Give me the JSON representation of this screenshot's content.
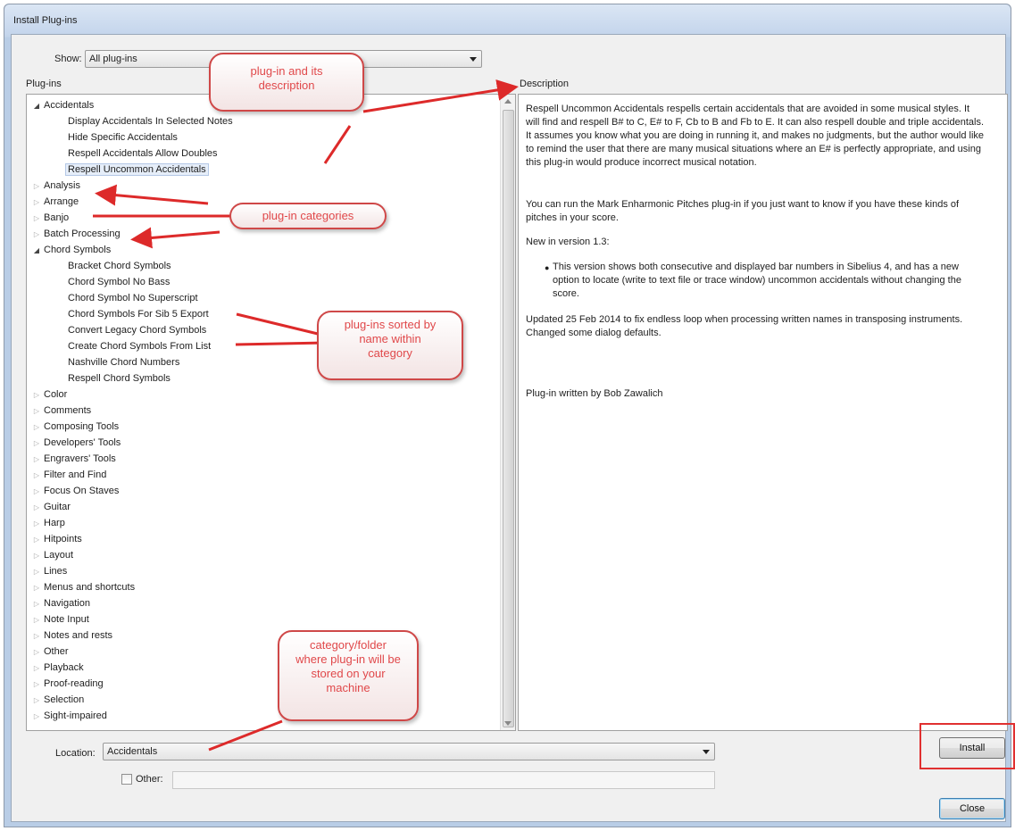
{
  "window": {
    "title": "Install Plug-ins"
  },
  "show": {
    "label": "Show:",
    "value": "All plug-ins"
  },
  "plugins_header": "Plug-ins",
  "description_header": "Description",
  "tree": [
    {
      "label": "Accidentals",
      "level": 0,
      "expanded": true
    },
    {
      "label": "Display Accidentals In Selected Notes",
      "level": 1
    },
    {
      "label": "Hide Specific Accidentals",
      "level": 1
    },
    {
      "label": "Respell Accidentals Allow Doubles",
      "level": 1
    },
    {
      "label": "Respell Uncommon Accidentals",
      "level": 1,
      "selected": true
    },
    {
      "label": "Analysis",
      "level": 0,
      "expanded": false
    },
    {
      "label": "Arrange",
      "level": 0,
      "expanded": false
    },
    {
      "label": "Banjo",
      "level": 0,
      "expanded": false
    },
    {
      "label": "Batch Processing",
      "level": 0,
      "expanded": false
    },
    {
      "label": "Chord Symbols",
      "level": 0,
      "expanded": true
    },
    {
      "label": "Bracket Chord Symbols",
      "level": 1
    },
    {
      "label": "Chord Symbol No Bass",
      "level": 1
    },
    {
      "label": "Chord Symbol No Superscript",
      "level": 1
    },
    {
      "label": "Chord Symbols For Sib 5 Export",
      "level": 1
    },
    {
      "label": "Convert Legacy Chord Symbols",
      "level": 1
    },
    {
      "label": "Create Chord Symbols From List",
      "level": 1
    },
    {
      "label": "Nashville Chord Numbers",
      "level": 1
    },
    {
      "label": "Respell Chord Symbols",
      "level": 1
    },
    {
      "label": "Color",
      "level": 0,
      "expanded": false
    },
    {
      "label": "Comments",
      "level": 0,
      "expanded": false
    },
    {
      "label": "Composing Tools",
      "level": 0,
      "expanded": false
    },
    {
      "label": "Developers' Tools",
      "level": 0,
      "expanded": false
    },
    {
      "label": "Engravers' Tools",
      "level": 0,
      "expanded": false
    },
    {
      "label": "Filter and Find",
      "level": 0,
      "expanded": false
    },
    {
      "label": "Focus On Staves",
      "level": 0,
      "expanded": false
    },
    {
      "label": "Guitar",
      "level": 0,
      "expanded": false
    },
    {
      "label": "Harp",
      "level": 0,
      "expanded": false
    },
    {
      "label": "Hitpoints",
      "level": 0,
      "expanded": false
    },
    {
      "label": "Layout",
      "level": 0,
      "expanded": false
    },
    {
      "label": "Lines",
      "level": 0,
      "expanded": false
    },
    {
      "label": "Menus and shortcuts",
      "level": 0,
      "expanded": false
    },
    {
      "label": "Navigation",
      "level": 0,
      "expanded": false
    },
    {
      "label": "Note Input",
      "level": 0,
      "expanded": false
    },
    {
      "label": "Notes and rests",
      "level": 0,
      "expanded": false
    },
    {
      "label": "Other",
      "level": 0,
      "expanded": false
    },
    {
      "label": "Playback",
      "level": 0,
      "expanded": false
    },
    {
      "label": "Proof-reading",
      "level": 0,
      "expanded": false
    },
    {
      "label": "Selection",
      "level": 0,
      "expanded": false
    },
    {
      "label": "Sight-impaired",
      "level": 0,
      "expanded": false
    }
  ],
  "description": {
    "p1": "Respell Uncommon Accidentals respells certain accidentals that are avoided in some musical styles. It will find and respell B# to C, E# to F, Cb to B and Fb to E. It can also respell double and triple accidentals. It assumes you know what you are doing in running it, and makes no judgments, but the author would like to remind the user that there are many musical situations where an E# is perfectly appropriate, and using this plug-in would produce incorrect musical notation.",
    "p2": "You can run the Mark Enharmonic Pitches plug-in if you just want to know if you have these kinds of pitches in your score.",
    "p3": "New in version 1.3:",
    "bullet": "This version shows both consecutive and displayed bar numbers in Sibelius 4, and has a new option to locate (write to text file or trace window) uncommon accidentals without changing the score.",
    "p4": "Updated 25 Feb 2014 to fix endless loop when processing written names in transposing instruments. Changed some dialog defaults.",
    "p5": "Plug-in written by Bob Zawalich"
  },
  "location": {
    "label": "Location:",
    "value": "Accidentals"
  },
  "other": {
    "label": "Other:",
    "value": ""
  },
  "buttons": {
    "install": "Install",
    "close": "Close"
  },
  "annotations": {
    "plugin_desc": [
      "plug-in and its",
      "description"
    ],
    "categories": [
      "plug-in categories"
    ],
    "sorted": [
      "plug-ins sorted by",
      "name within",
      "category"
    ],
    "folder": [
      "category/folder",
      "where plug-in will be",
      "stored on your",
      "machine"
    ]
  },
  "colors": {
    "annotation": "#e0484a",
    "selection": "#e6eef9",
    "titlebar": "#c4d5ec"
  }
}
